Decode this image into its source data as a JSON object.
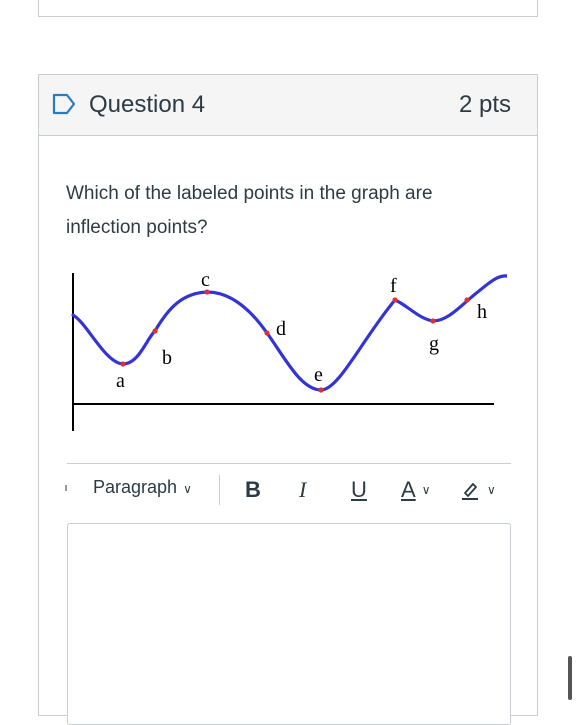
{
  "question": {
    "title": "Question 4",
    "points": "2 pts",
    "text": "Which of the labeled points in the graph are inflection points?"
  },
  "graph": {
    "curve_color": "#3434d4",
    "point_color": "#e23030",
    "points": [
      {
        "label": "a"
      },
      {
        "label": "b"
      },
      {
        "label": "c"
      },
      {
        "label": "d"
      },
      {
        "label": "e"
      },
      {
        "label": "f"
      },
      {
        "label": "g"
      },
      {
        "label": "h"
      }
    ]
  },
  "editor": {
    "paragraph_label": "Paragraph",
    "bold_label": "B",
    "italic_label": "I",
    "underline_label": "U",
    "font_color_label": "A",
    "icons": [
      "chevron-down-icon",
      "font-color-icon",
      "highlight-pen-icon"
    ]
  }
}
